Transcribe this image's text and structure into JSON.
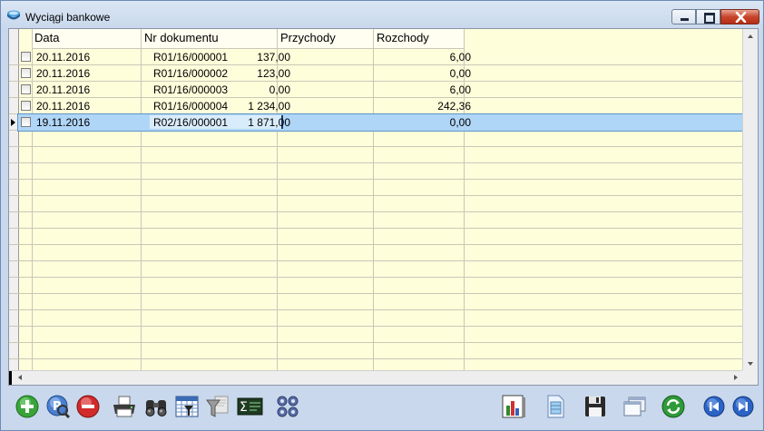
{
  "window": {
    "title": "Wyciągi bankowe",
    "icons": {
      "app": "bank-statement-icon",
      "minimize": "minimize-icon",
      "maximize": "maximize-icon",
      "close": "close-icon"
    }
  },
  "table": {
    "columns": [
      "Data",
      "Nr dokumentu",
      "Przychody",
      "Rozchody"
    ],
    "rows": [
      {
        "date": "20.11.2016",
        "doc": "R01/16/000001",
        "income": "137,00",
        "expense": "6,00",
        "selected": false
      },
      {
        "date": "20.11.2016",
        "doc": "R01/16/000002",
        "income": "123,00",
        "expense": "0,00",
        "selected": false
      },
      {
        "date": "20.11.2016",
        "doc": "R01/16/000003",
        "income": "0,00",
        "expense": "6,00",
        "selected": false
      },
      {
        "date": "20.11.2016",
        "doc": "R01/16/000004",
        "income": "1 234,00",
        "expense": "242,36",
        "selected": false
      },
      {
        "date": "19.11.2016",
        "doc": "R02/16/000001",
        "income": "1 871,00",
        "expense": "0,00",
        "selected": true
      }
    ],
    "selected_row_index": 4
  },
  "colors": {
    "grid_bg": "#fffedb",
    "selected_row": "#b0d6f7",
    "close_button": "#c8452c"
  },
  "toolbar": {
    "left_icons": [
      "add-icon",
      "preview-icon",
      "delete-icon",
      "print-icon",
      "binoculars-search-icon",
      "calendar-filter-icon",
      "funnel-filter-icon",
      "sum-icon",
      "gears-icon"
    ],
    "right_icons": [
      "chart-icon",
      "document-icon",
      "save-icon",
      "windows-icon",
      "refresh-icon",
      "previous-icon",
      "next-icon"
    ]
  }
}
